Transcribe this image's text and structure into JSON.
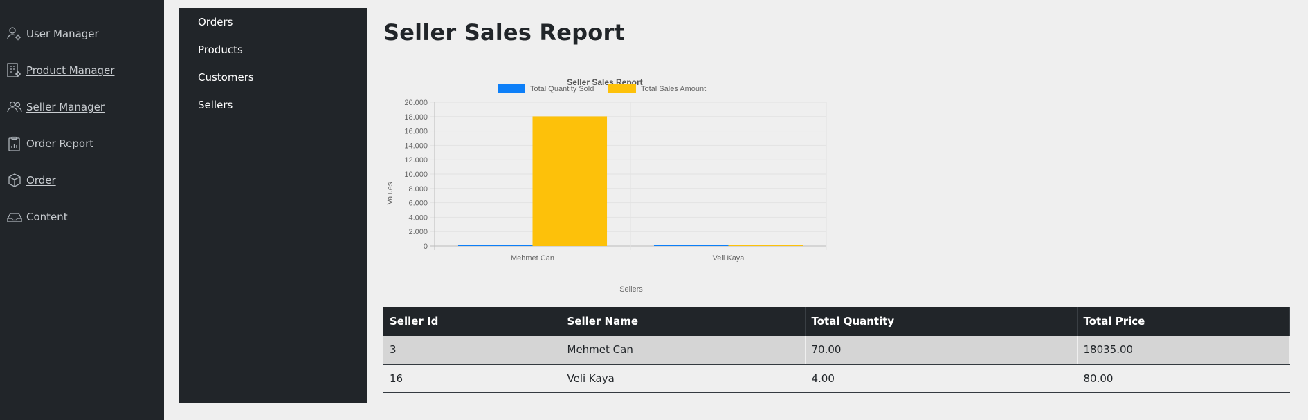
{
  "sidebar": {
    "items": [
      {
        "label": "User Manager",
        "icon": "user-gear-icon"
      },
      {
        "label": "Product Manager",
        "icon": "grid-gear-icon"
      },
      {
        "label": "Seller Manager",
        "icon": "users-icon"
      },
      {
        "label": "Order Report",
        "icon": "clipboard-chart-icon"
      },
      {
        "label": "Order",
        "icon": "box-icon"
      },
      {
        "label": "Content",
        "icon": "inbox-icon"
      }
    ]
  },
  "subnav": {
    "items": [
      {
        "label": "Orders"
      },
      {
        "label": "Products"
      },
      {
        "label": "Customers"
      },
      {
        "label": "Sellers"
      }
    ]
  },
  "page": {
    "title": "Seller Sales Report"
  },
  "chart_data": {
    "type": "bar",
    "title": "Seller Sales Report",
    "xlabel": "Sellers",
    "ylabel": "Values",
    "categories": [
      "Mehmet Can",
      "Veli Kaya"
    ],
    "series": [
      {
        "name": "Total Quantity Sold",
        "values": [
          70,
          4
        ],
        "color": "#0d7ff8"
      },
      {
        "name": "Total Sales Amount",
        "values": [
          18035,
          80
        ],
        "color": "#fdc10a"
      }
    ],
    "ylim": [
      0,
      20000
    ],
    "yticks": [
      0,
      2000,
      4000,
      6000,
      8000,
      10000,
      12000,
      14000,
      16000,
      18000,
      20000
    ],
    "ytick_labels": [
      "0",
      "2.000",
      "4.000",
      "6.000",
      "8.000",
      "10.000",
      "12.000",
      "14.000",
      "16.000",
      "18.000",
      "20.000"
    ],
    "legend": "top",
    "grid": true
  },
  "table": {
    "headers": [
      "Seller Id",
      "Seller Name",
      "Total Quantity",
      "Total Price"
    ],
    "rows": [
      [
        "3",
        "Mehmet Can",
        "70.00",
        "18035.00"
      ],
      [
        "16",
        "Veli Kaya",
        "4.00",
        "80.00"
      ]
    ]
  }
}
